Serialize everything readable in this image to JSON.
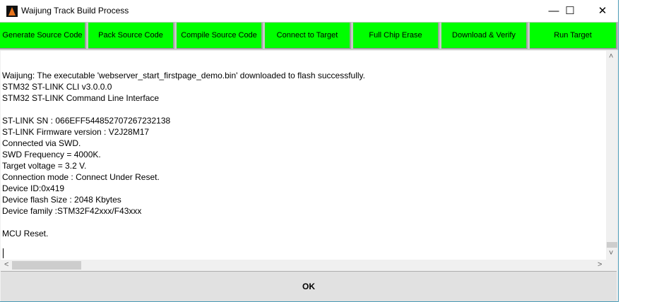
{
  "window": {
    "title": "Waijung Track Build Process",
    "minimize": "—",
    "maximize": "☐",
    "close": "✕"
  },
  "toolbar": {
    "buttons": [
      "Generate Source Code",
      "Pack Source Code",
      "Compile Source Code",
      "Connect to Target",
      "Full Chip Erase",
      "Download & Verify",
      "Run Target"
    ],
    "color": "#00ff00"
  },
  "log": {
    "text": "Waijung: The executable 'webserver_start_firstpage_demo.bin' downloaded to flash successfully.\nSTM32 ST-LINK CLI v3.0.0.0\nSTM32 ST-LINK Command Line Interface\n\nST-LINK SN : 066EFF544852707267232138\nST-LINK Firmware version : V2J28M17\nConnected via SWD.\nSWD Frequency = 4000K.\nTarget voltage = 3.2 V.\nConnection mode : Connect Under Reset.\nDevice ID:0x419\nDevice flash Size : 2048 Kbytes\nDevice family :STM32F42xxx/F43xxx\n\nMCU Reset."
  },
  "scroll": {
    "up": "˄",
    "down": "˅",
    "left": "<",
    "right": ">"
  },
  "ok_label": "OK"
}
